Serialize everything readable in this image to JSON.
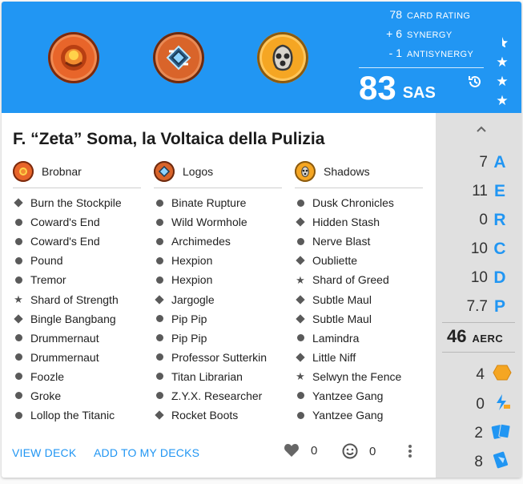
{
  "header": {
    "houses": [
      {
        "name": "Brobnar",
        "icon": "brobnar-icon"
      },
      {
        "name": "Logos",
        "icon": "logos-icon"
      },
      {
        "name": "Shadows",
        "icon": "shadows-icon"
      }
    ],
    "ratings": [
      {
        "value": "78",
        "label": "CARD RATING"
      },
      {
        "value": "+ 6",
        "label": "SYNERGY"
      },
      {
        "value": "- 1",
        "label": "ANTISYNERGY"
      }
    ],
    "sas_value": "83",
    "sas_label": "SAS",
    "stars": [
      "half-star-icon",
      "star-icon",
      "star-icon",
      "star-icon"
    ]
  },
  "deck": {
    "title": "F. “Zeta” Soma, la Voltaica della Pulizia"
  },
  "columns": [
    {
      "house": "Brobnar",
      "cards": [
        {
          "name": "Burn the Stockpile",
          "type": "diamond"
        },
        {
          "name": "Coward's End",
          "type": "dot"
        },
        {
          "name": "Coward's End",
          "type": "dot"
        },
        {
          "name": "Pound",
          "type": "dot"
        },
        {
          "name": "Tremor",
          "type": "dot"
        },
        {
          "name": "Shard of Strength",
          "type": "star"
        },
        {
          "name": "Bingle Bangbang",
          "type": "diamond"
        },
        {
          "name": "Drummernaut",
          "type": "dot"
        },
        {
          "name": "Drummernaut",
          "type": "dot"
        },
        {
          "name": "Foozle",
          "type": "dot"
        },
        {
          "name": "Groke",
          "type": "dot"
        },
        {
          "name": "Lollop the Titanic",
          "type": "dot"
        }
      ]
    },
    {
      "house": "Logos",
      "cards": [
        {
          "name": "Binate Rupture",
          "type": "dot"
        },
        {
          "name": "Wild Wormhole",
          "type": "dot"
        },
        {
          "name": "Archimedes",
          "type": "dot"
        },
        {
          "name": "Hexpion",
          "type": "dot"
        },
        {
          "name": "Hexpion",
          "type": "dot"
        },
        {
          "name": "Jargogle",
          "type": "diamond"
        },
        {
          "name": "Pip Pip",
          "type": "dot"
        },
        {
          "name": "Pip Pip",
          "type": "dot"
        },
        {
          "name": "Professor Sutterkin",
          "type": "dot"
        },
        {
          "name": "Titan Librarian",
          "type": "dot"
        },
        {
          "name": "Z.Y.X. Researcher",
          "type": "dot"
        },
        {
          "name": "Rocket Boots",
          "type": "diamond"
        }
      ]
    },
    {
      "house": "Shadows",
      "cards": [
        {
          "name": "Dusk Chronicles",
          "type": "dot"
        },
        {
          "name": "Hidden Stash",
          "type": "diamond"
        },
        {
          "name": "Nerve Blast",
          "type": "dot"
        },
        {
          "name": "Oubliette",
          "type": "diamond"
        },
        {
          "name": "Shard of Greed",
          "type": "star"
        },
        {
          "name": "Subtle Maul",
          "type": "diamond"
        },
        {
          "name": "Subtle Maul",
          "type": "diamond"
        },
        {
          "name": "Lamindra",
          "type": "dot"
        },
        {
          "name": "Little Niff",
          "type": "diamond"
        },
        {
          "name": "Selwyn the Fence",
          "type": "star"
        },
        {
          "name": "Yantzee Gang",
          "type": "dot"
        },
        {
          "name": "Yantzee Gang",
          "type": "dot"
        }
      ]
    }
  ],
  "footer": {
    "view_deck": "VIEW DECK",
    "add_to_my_decks": "ADD TO MY DECKS",
    "likes": "0",
    "funny": "0"
  },
  "stats": {
    "A": "7",
    "E": "11",
    "R": "0",
    "C": "10",
    "D": "10",
    "P": "7.7",
    "aerc_value": "46",
    "aerc_label": "AERC",
    "amber": "4",
    "efficiency_power": "0",
    "cards_drawn": "2",
    "discard": "8"
  },
  "colors": {
    "accent": "#2196f3",
    "panel": "#e0e0e0",
    "amber": "#f5a623"
  }
}
